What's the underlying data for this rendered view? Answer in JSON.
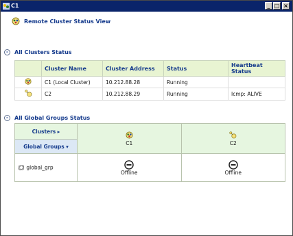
{
  "window": {
    "title": "C1"
  },
  "view": {
    "title": "Remote Cluster Status View"
  },
  "clusters_section": {
    "title": "All Clusters Status",
    "columns": [
      "Cluster Name",
      "Cluster Address",
      "Status",
      "Heartbeat Status"
    ],
    "rows": [
      {
        "name": "C1 (Local Cluster)",
        "address": "10.212.88.28",
        "status": "Running",
        "heartbeat": ""
      },
      {
        "name": "C2",
        "address": "10.212.88.29",
        "status": "Running",
        "heartbeat": "Icmp: ALIVE"
      }
    ]
  },
  "groups_section": {
    "title": "All Global Groups Status",
    "clusters_header": "Clusters",
    "clusters_arrow": "▸",
    "groups_header": "Global Groups",
    "groups_arrow": "▾",
    "cluster_cols": [
      "C1",
      "C2"
    ],
    "rows": [
      {
        "name": "global_grp",
        "states": [
          "Offline",
          "Offline"
        ]
      }
    ]
  },
  "colors": {
    "titlebar": "#0a246a",
    "accent_text": "#143a8c",
    "header_green": "#e8f4d2",
    "header_blue": "#dce8f5"
  },
  "icons": [
    "cluster-icon",
    "remote-cluster-icon",
    "group-icon",
    "offline-icon"
  ]
}
